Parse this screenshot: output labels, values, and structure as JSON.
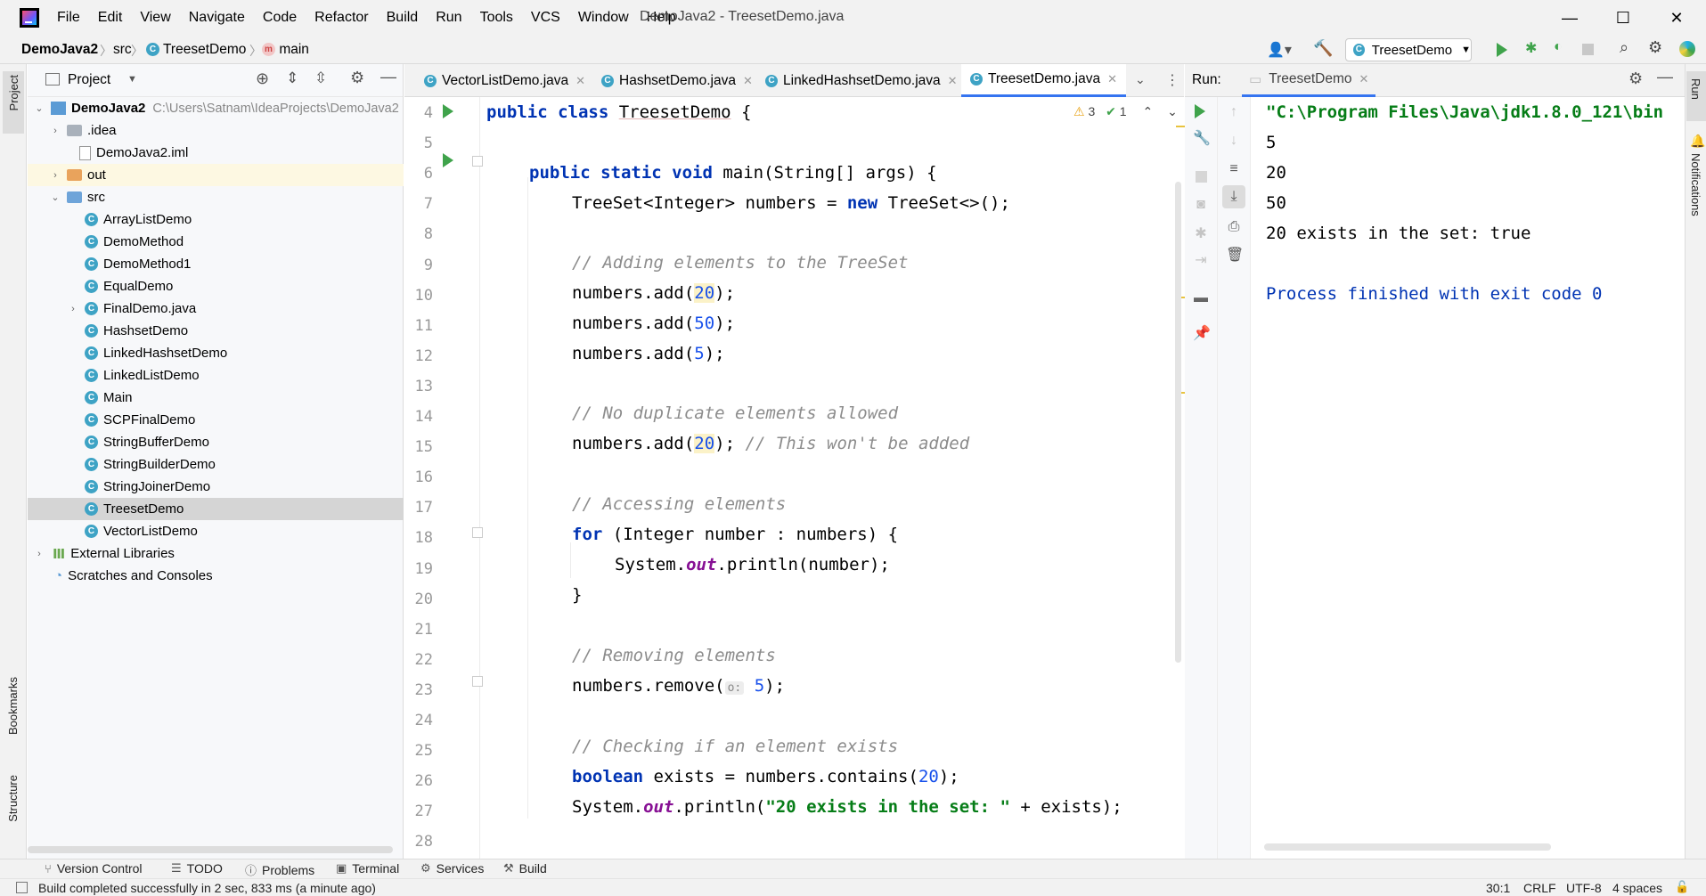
{
  "window": {
    "title": "DemoJava2 - TreesetDemo.java",
    "menu": [
      "File",
      "Edit",
      "View",
      "Navigate",
      "Code",
      "Refactor",
      "Build",
      "Run",
      "Tools",
      "VCS",
      "Window",
      "Help"
    ],
    "controls": {
      "minimize": "—",
      "maximize": "☐",
      "close": "✕"
    }
  },
  "navbar": {
    "breadcrumbs": [
      "DemoJava2",
      "src",
      "TreesetDemo",
      "main"
    ],
    "run_config": "TreesetDemo"
  },
  "project": {
    "title": "Project",
    "root_name": "DemoJava2",
    "root_path": "C:\\Users\\Satnam\\IdeaProjects\\DemoJava2",
    "items": [
      {
        "label": ".idea",
        "type": "folder"
      },
      {
        "label": "DemoJava2.iml",
        "type": "file"
      },
      {
        "label": "out",
        "type": "folder-orange"
      },
      {
        "label": "src",
        "type": "folder-blue"
      },
      {
        "label": "ArrayListDemo",
        "type": "class"
      },
      {
        "label": "DemoMethod",
        "type": "class"
      },
      {
        "label": "DemoMethod1",
        "type": "class"
      },
      {
        "label": "EqualDemo",
        "type": "class"
      },
      {
        "label": "FinalDemo.java",
        "type": "class"
      },
      {
        "label": "HashsetDemo",
        "type": "class"
      },
      {
        "label": "LinkedHashsetDemo",
        "type": "class"
      },
      {
        "label": "LinkedListDemo",
        "type": "class"
      },
      {
        "label": "Main",
        "type": "class"
      },
      {
        "label": "SCPFinalDemo",
        "type": "class"
      },
      {
        "label": "StringBufferDemo",
        "type": "class"
      },
      {
        "label": "StringBuilderDemo",
        "type": "class"
      },
      {
        "label": "StringJoinerDemo",
        "type": "class"
      },
      {
        "label": "TreesetDemo",
        "type": "class"
      },
      {
        "label": "VectorListDemo",
        "type": "class"
      },
      {
        "label": "External Libraries",
        "type": "lib"
      },
      {
        "label": "Scratches and Consoles",
        "type": "scratch"
      }
    ]
  },
  "editor": {
    "tabs": [
      "VectorListDemo.java",
      "HashsetDemo.java",
      "LinkedHashsetDemo.java",
      "TreesetDemo.java"
    ],
    "active_tab": "TreesetDemo.java",
    "inspections": {
      "warnings": "3",
      "checks": "1"
    },
    "line_numbers": [
      "4",
      "5",
      "6",
      "7",
      "8",
      "9",
      "10",
      "11",
      "12",
      "13",
      "14",
      "15",
      "16",
      "17",
      "18",
      "19",
      "20",
      "21",
      "22",
      "23",
      "24",
      "25",
      "26",
      "27",
      "28"
    ],
    "code": {
      "l4": {
        "kw": "public class ",
        "name": "TreesetDemo",
        " rest": " {"
      },
      "l6": {
        "kw": "public static void ",
        "rest": "main(String[] args) {"
      },
      "l7": {
        "a": "TreeSet<Integer> numbers = ",
        "kw": "new",
        "b": " TreeSet<>();"
      },
      "l9": "// Adding elements to the TreeSet",
      "l10": {
        "a": "numbers.add(",
        "n": "20",
        "b": ");"
      },
      "l11": {
        "a": "numbers.add(",
        "n": "50",
        "b": ");"
      },
      "l12": {
        "a": "numbers.add(",
        "n": "5",
        "b": ");"
      },
      "l14": "// No duplicate elements allowed",
      "l15": {
        "a": "numbers.add(",
        "n": "20",
        "b": "); ",
        "c": "// This won't be added"
      },
      "l17": "// Accessing elements",
      "l18": {
        "kw": "for",
        "rest": " (Integer number : numbers) {"
      },
      "l19": {
        "a": "System.",
        "it": "out",
        "b": ".println(number);"
      },
      "l20": "}",
      "l22": "// Removing elements",
      "l23": {
        "a": "numbers.remove(",
        "hint": "o:",
        "n": "5",
        "b": ");"
      },
      "l25": "// Checking if an element exists",
      "l26": {
        "kw": "boolean",
        "a": " exists = numbers.contains(",
        "n": "20",
        "b": ");"
      },
      "l27": {
        "a": "System.",
        "it": "out",
        "b": ".println(",
        "s": "\"20 exists in the set: \"",
        "c": " + exists);"
      }
    }
  },
  "run": {
    "label": "Run:",
    "tab": "TreesetDemo",
    "output": [
      "\"C:\\Program Files\\Java\\jdk1.8.0_121\\bin",
      "5",
      "20",
      "50",
      "20 exists in the set: true",
      "",
      "Process finished with exit code 0"
    ]
  },
  "side": {
    "left_top": "Project",
    "left_bookmarks": "Bookmarks",
    "left_structure": "Structure",
    "right_run": "Run",
    "right_notifications": "Notifications"
  },
  "toolwindows": [
    "Version Control",
    "TODO",
    "Problems",
    "Terminal",
    "Services",
    "Build"
  ],
  "status": {
    "message": "Build completed successfully in 2 sec, 833 ms (a minute ago)",
    "position": "30:1",
    "line_sep": "CRLF",
    "encoding": "UTF-8",
    "indent": "4 spaces"
  },
  "colors": {
    "keyword": "#0033b3",
    "string": "#067d17",
    "number": "#1750eb",
    "comment": "#8c8c8c",
    "accent": "#3574f0",
    "run_green": "#3fa34b"
  }
}
